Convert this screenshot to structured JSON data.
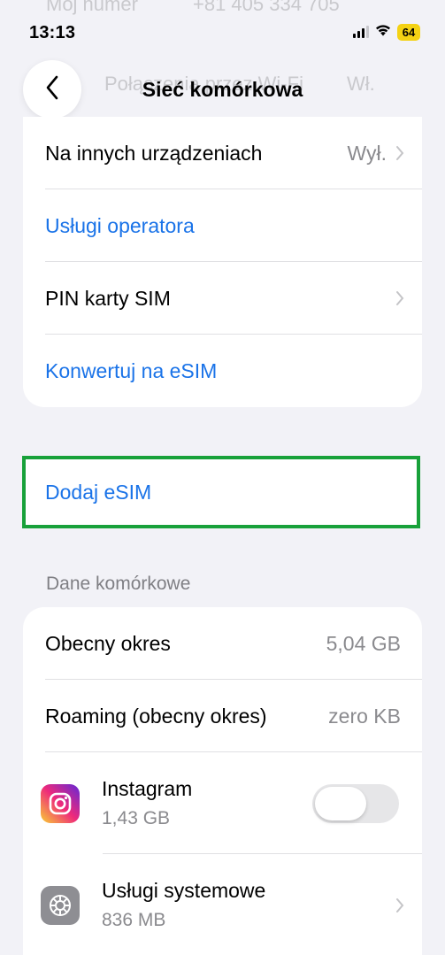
{
  "ghost": {
    "row1_label": "Mój numer",
    "row1_value": "+81 405 334 705",
    "row2_label": "Połączenia przez Wi-Fi",
    "row2_value": "Wł."
  },
  "status_bar": {
    "time": "13:13",
    "battery": "64",
    "battery_color": "#f4d214"
  },
  "nav": {
    "title": "Sieć komórkowa",
    "back_icon": "chevron-left-icon"
  },
  "section1": {
    "rows": [
      {
        "label": "Na innych urządzeniach",
        "value": "Wył."
      },
      {
        "label": "Usługi operatora"
      },
      {
        "label": "PIN karty SIM"
      },
      {
        "label": "Konwertuj na eSIM"
      }
    ]
  },
  "add_esim": {
    "label": "Dodaj eSIM",
    "highlight_color": "#18a13a"
  },
  "cellular_data": {
    "header": "Dane komórkowe",
    "current_period_label": "Obecny okres",
    "current_period_value": "5,04 GB",
    "roaming_label": "Roaming (obecny okres)",
    "roaming_value": "zero KB",
    "apps": [
      {
        "name": "Instagram",
        "usage": "1,43 GB",
        "icon": "instagram-icon",
        "toggle_on": false
      },
      {
        "name": "Usługi systemowe",
        "usage": "836 MB",
        "icon": "gear-icon"
      }
    ]
  },
  "colors": {
    "link": "#1a73e8",
    "background": "#f2f2f7"
  }
}
